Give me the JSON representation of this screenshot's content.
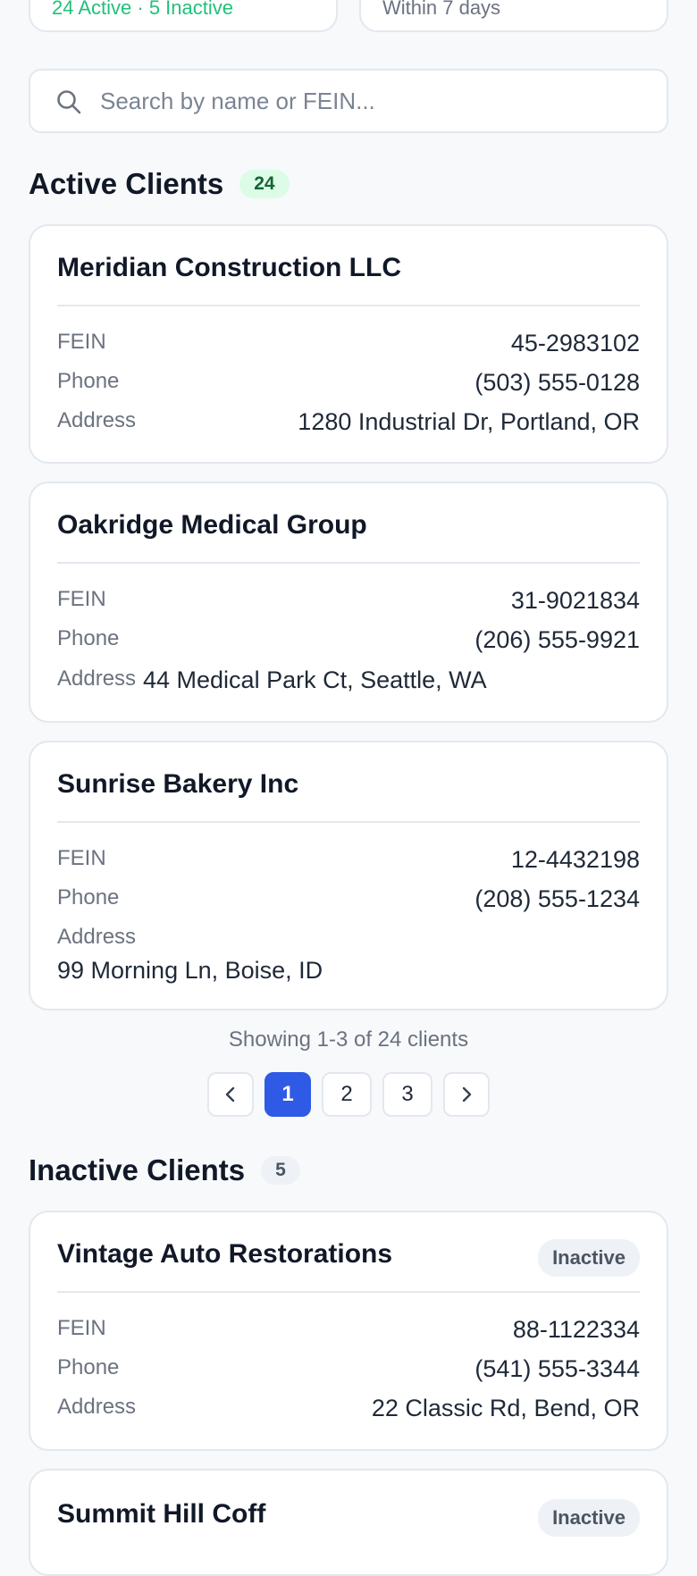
{
  "summary": {
    "active_text": "24 Active · 5 Inactive",
    "expiring_text": "Within 7 days"
  },
  "search": {
    "placeholder": "Search by name or FEIN..."
  },
  "active_section": {
    "title": "Active Clients",
    "count": "24",
    "clients": [
      {
        "name": "Meridian Construction LLC",
        "fein_label": "FEIN",
        "fein": "45-2983102",
        "phone_label": "Phone",
        "phone": "(503) 555-0128",
        "address_label": "Address",
        "address": "1280 Industrial Dr, Portland, OR"
      },
      {
        "name": "Oakridge Medical Group",
        "fein_label": "FEIN",
        "fein": "31-9021834",
        "phone_label": "Phone",
        "phone": "(206) 555-9921",
        "address_label": "Address",
        "address": "44 Medical Park Ct, Seattle, WA"
      },
      {
        "name": "Sunrise Bakery Inc",
        "fein_label": "FEIN",
        "fein": "12-4432198",
        "phone_label": "Phone",
        "phone": "(208) 555-1234",
        "address_label": "Address",
        "address": "99 Morning Ln, Boise, ID"
      }
    ],
    "showing_text": "Showing 1-3 of 24 clients",
    "pages": [
      "1",
      "2",
      "3"
    ],
    "current_page": "1"
  },
  "inactive_section": {
    "title": "Inactive Clients",
    "count": "5",
    "clients": [
      {
        "name": "Vintage Auto Restorations",
        "status": "Inactive",
        "fein_label": "FEIN",
        "fein": "88-1122334",
        "phone_label": "Phone",
        "phone": "(541) 555-3344",
        "address_label": "Address",
        "address": "22 Classic Rd, Bend, OR"
      },
      {
        "name": "Summit Hill Coff",
        "status": "Inactive"
      }
    ]
  }
}
